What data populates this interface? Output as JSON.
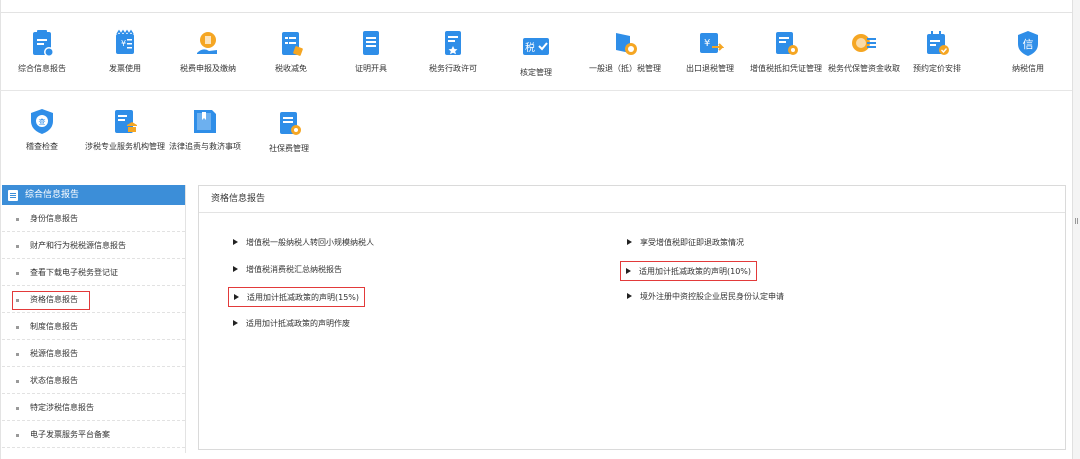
{
  "colors": {
    "accent": "#3c8ed8",
    "highlight": "#e23a3a",
    "icon_blue": "#2f8ee8",
    "icon_orange": "#f5a623"
  },
  "top_modules": [
    {
      "label": "综合信息报告",
      "icon": "document-report-icon"
    },
    {
      "label": "发票使用",
      "icon": "invoice-yuan-icon"
    },
    {
      "label": "税费申报及缴纳",
      "icon": "tax-payment-icon"
    },
    {
      "label": "税收减免",
      "icon": "tax-reduction-icon"
    },
    {
      "label": "证明开具",
      "icon": "certificate-icon"
    },
    {
      "label": "税务行政许可",
      "icon": "permit-icon"
    },
    {
      "label": "核定管理",
      "icon": "tax-approval-icon"
    },
    {
      "label": "一般退（抵）税管理",
      "icon": "tax-refund-icon"
    },
    {
      "label": "出口退税管理",
      "icon": "export-refund-icon"
    },
    {
      "label": "增值税抵扣凭证管理",
      "icon": "vat-deduction-icon"
    },
    {
      "label": "税务代保管资金收取",
      "icon": "custody-fund-icon"
    },
    {
      "label": "预约定价安排",
      "icon": "pricing-schedule-icon"
    },
    {
      "label": "纳税信用",
      "icon": "tax-credit-icon"
    },
    {
      "label": "稽查检查",
      "icon": "inspection-shield-icon"
    },
    {
      "label": "涉税专业服务机构管理",
      "icon": "agency-management-icon"
    },
    {
      "label": "法律追责与救济事项",
      "icon": "legal-book-icon"
    },
    {
      "label": "社保费管理",
      "icon": "social-insurance-icon"
    }
  ],
  "sidebar": {
    "title": "综合信息报告",
    "items": [
      {
        "label": "身份信息报告"
      },
      {
        "label": "财产和行为税税源信息报告"
      },
      {
        "label": "查看下载电子税务登记证"
      },
      {
        "label": "资格信息报告"
      },
      {
        "label": "制度信息报告"
      },
      {
        "label": "税源信息报告"
      },
      {
        "label": "状态信息报告"
      },
      {
        "label": "特定涉税信息报告"
      },
      {
        "label": "电子发票服务平台备案"
      }
    ]
  },
  "main": {
    "title": "资格信息报告",
    "links": [
      {
        "label": "增值税一般纳税人转回小规模纳税人"
      },
      {
        "label": "增值税消费税汇总纳税报告"
      },
      {
        "label": "适用加计抵减政策的声明(15%)"
      },
      {
        "label": "适用加计抵减政策的声明作废"
      },
      {
        "label": "享受增值税即征即退政策情况"
      },
      {
        "label": "适用加计抵减政策的声明(10%)"
      },
      {
        "label": "境外注册中资控股企业居民身份认定申请"
      }
    ]
  }
}
